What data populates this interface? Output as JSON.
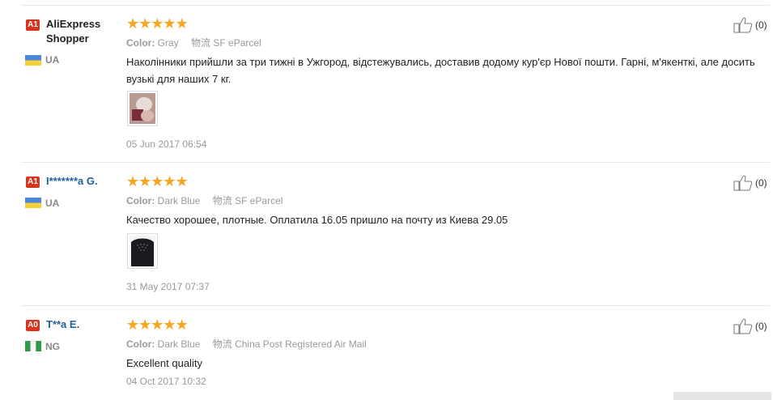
{
  "reviews": [
    {
      "level": "A1",
      "name": "AliExpress Shopper",
      "country": "UA",
      "rating": 5,
      "color_label": "Color:",
      "color_value": "Gray",
      "logistics_label": "物流",
      "logistics_value": "SF eParcel",
      "text": "Наколінники прийшли за три тижні в Ужгород, відстежувались, доставив додому кур'єр Нової пошти. Гарні, м'якенткі, але досить вузькі для наших 7 кг.",
      "date": "05 Jun 2017 06:54",
      "useful": "(0)"
    },
    {
      "level": "A1",
      "name": "I*******a G.",
      "country": "UA",
      "rating": 5,
      "color_label": "Color:",
      "color_value": "Dark Blue",
      "logistics_label": "物流",
      "logistics_value": "SF eParcel",
      "text": "Качество хорошее, плотные. Оплатила 16.05 пришло на почту из Киева 29.05",
      "date": "31 May 2017 07:37",
      "useful": "(0)"
    },
    {
      "level": "A0",
      "name": "T**a E.",
      "country": "NG",
      "rating": 5,
      "color_label": "Color:",
      "color_value": "Dark Blue",
      "logistics_label": "物流",
      "logistics_value": "China Post Registered Air Mail",
      "text": "Excellent quality",
      "date": "04 Oct 2017 10:32",
      "useful": "(0)"
    }
  ],
  "colors": {
    "badge": "#d8331f",
    "star": "#f5a623",
    "buyer_name_link": "#1f5f9c",
    "meta_text": "#999999"
  },
  "icons": {
    "level_badge": "badge",
    "flag_ua": "ukraine-flag",
    "flag_ng": "nigeria-flag",
    "rating": "star",
    "useful": "thumbs-up"
  }
}
